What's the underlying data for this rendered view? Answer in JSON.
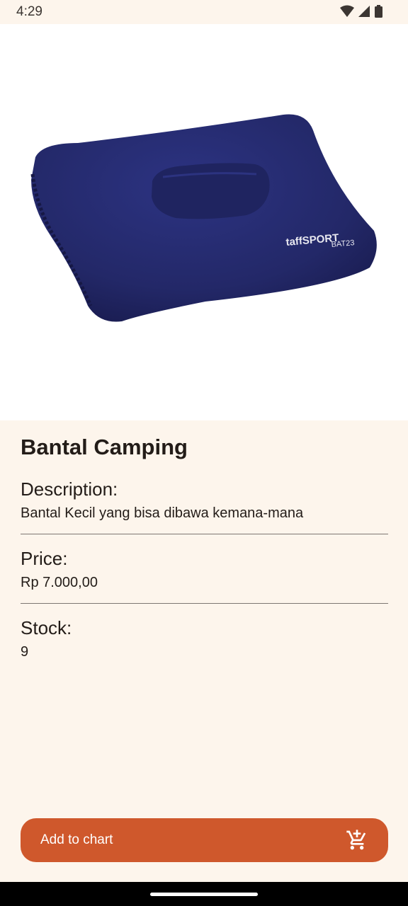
{
  "status_bar": {
    "time": "4:29"
  },
  "product": {
    "image_brand": "taffSPORT",
    "image_code": "BAT23",
    "name": "Bantal Camping",
    "description_label": "Description:",
    "description": "Bantal Kecil yang bisa dibawa kemana-mana",
    "price_label": "Price:",
    "price": "Rp 7.000,00",
    "stock_label": "Stock:",
    "stock": "9"
  },
  "actions": {
    "add_to_cart_label": "Add to chart"
  },
  "colors": {
    "accent": "#cf582c",
    "background": "#fdf5ec",
    "pillow": "#252a6e"
  }
}
